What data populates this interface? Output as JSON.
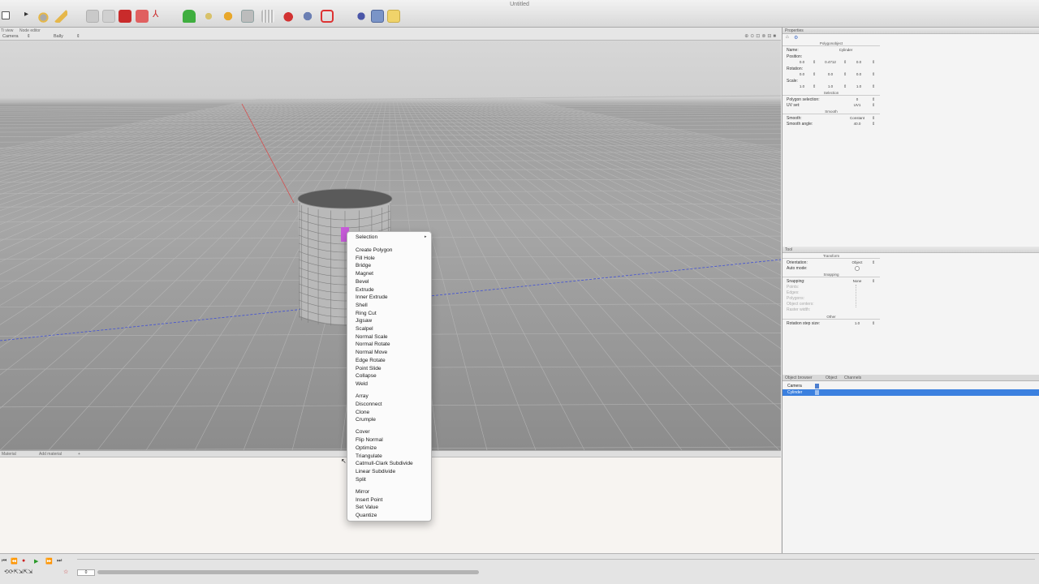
{
  "window": {
    "title": "Untitled"
  },
  "viewport": {
    "tabs": [
      "Ti view",
      "Node editor"
    ],
    "camera_label": "Camera",
    "shading_label": "Bally",
    "icons": [
      "grid-icon",
      "zoom-icon",
      "fit-icon",
      "orbit-icon",
      "lock-icon",
      "maximize-icon"
    ]
  },
  "context_menu": {
    "header": "Selection",
    "groups": [
      [
        "Create Polygon",
        "Fill Hole",
        "Bridge",
        "Magnet",
        "Bevel",
        "Extrude",
        "Inner Extrude",
        "Shell",
        "Ring Cut",
        "Jigsaw",
        "Scalpel",
        "Normal Scale",
        "Normal Rotate",
        "Normal Move",
        "Edge Rotate",
        "Point Slide",
        "Collapse",
        "Weld"
      ],
      [
        "Array",
        "Disconnect",
        "Clone",
        "Crumple"
      ],
      [
        "Cover",
        "Flip Normal",
        "Optimize",
        "Triangulate",
        "Catmull-Clark Subdivide",
        "Linear Subdivide",
        "Split"
      ],
      [
        "Mirror",
        "Insert Point",
        "Set Value",
        "Quantize"
      ]
    ]
  },
  "bottom": {
    "tabs": [
      "Material",
      "Add material"
    ]
  },
  "properties": {
    "header": "Properties",
    "section": "Polygonobject",
    "name_label": "Name:",
    "name_value": "Cylinder",
    "position_label": "Position:",
    "position": [
      "0.0",
      "0.4712",
      "0.0"
    ],
    "rotation_label": "Rotation:",
    "rotation": [
      "0.0",
      "0.0",
      "0.0"
    ],
    "scale_label": "Scale:",
    "scale": [
      "1.0",
      "1.0",
      "1.0"
    ],
    "selection_section": "Selection",
    "polygon_selection_label": "Polygon selection:",
    "polygon_selection_value": "0",
    "uv_set_label": "UV set:",
    "uv_set_value": "UV1",
    "smooth_section": "Smooth",
    "smooth_label": "Smooth:",
    "smooth_value": "Constant",
    "smooth_angle_label": "Smooth angle:",
    "smooth_angle_value": "40.0"
  },
  "tool": {
    "header": "Tool",
    "transform_section": "Transform",
    "orientation_label": "Orientation:",
    "orientation_value": "Object",
    "auto_mode_label": "Auto mode:",
    "snapping_section": "Snapping",
    "snapping_label": "Snapping:",
    "snapping_value": "None",
    "points_label": "Points:",
    "edges_label": "Edges:",
    "polygons_label": "Polygons:",
    "object_centers_label": "Object centers:",
    "raster_width_label": "Raster width:",
    "other_section": "Other",
    "rotation_step_label": "Rotation step size:",
    "rotation_step_value": "1.0"
  },
  "object_browser": {
    "tabs": [
      "Object browser",
      "Object",
      "Channels"
    ],
    "items": [
      {
        "label": "Camera",
        "selected": false
      },
      {
        "label": "Cylinder",
        "selected": true
      }
    ]
  },
  "timeline": {
    "frame": "0"
  },
  "colors": {
    "selection_blue": "#3b80df",
    "axis_red": "#d84a4a",
    "axis_blue": "#3f4fd6",
    "highlight_magenta": "#c65bd8"
  }
}
